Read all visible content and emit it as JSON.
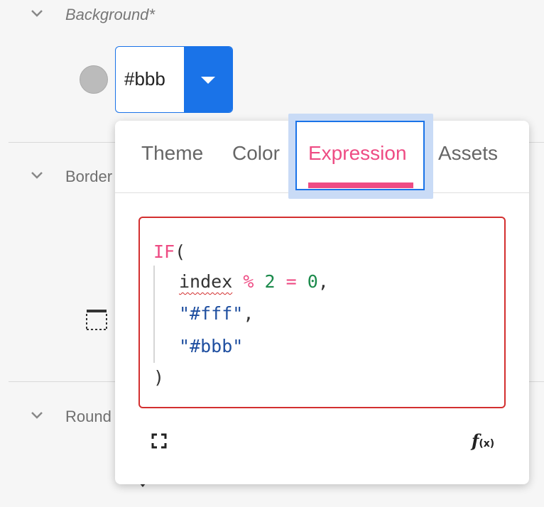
{
  "panel": {
    "background_section": {
      "title": "Background*",
      "expanded": true
    },
    "color_field": {
      "value": "#bbb",
      "swatch_color": "#bbbbbb"
    },
    "border_section": {
      "title": "Border"
    },
    "rounding_section": {
      "title": "Round"
    }
  },
  "popover": {
    "tabs": [
      {
        "label": "Theme"
      },
      {
        "label": "Color"
      },
      {
        "label": "Expression",
        "active": true
      },
      {
        "label": "Assets"
      }
    ],
    "expression": {
      "keyword": "IF",
      "open_paren": "(",
      "line2_ident": "index",
      "line2_op1": "%",
      "line2_num1": "2",
      "line2_op2": "=",
      "line2_num2": "0",
      "line2_comma": ",",
      "line3_str": "\"#fff\"",
      "line3_comma": ",",
      "line4_str": "\"#bbb\"",
      "close_paren": ")",
      "has_error": true
    },
    "footer": {
      "expand_icon": "fullscreen-icon",
      "fx_label": "f",
      "fx_sub": "(x)"
    }
  },
  "colors": {
    "accent": "#1a73e8",
    "active_tab": "#ee4c84",
    "error_border": "#d32f2f",
    "number": "#1b8a4b",
    "string": "#1f4fa0"
  }
}
